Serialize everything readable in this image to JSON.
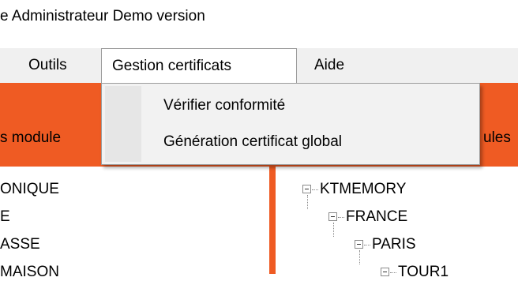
{
  "window": {
    "title": "e Administrateur Demo version"
  },
  "menubar": {
    "items": [
      {
        "label": "Outils"
      },
      {
        "label": "Gestion certificats"
      },
      {
        "label": "Aide"
      }
    ]
  },
  "dropdown": {
    "items": [
      {
        "label": "Vérifier conformité"
      },
      {
        "label": "Génération certificat global"
      }
    ]
  },
  "band": {
    "left_label": "s module",
    "right_label": "ules"
  },
  "left_list": {
    "items": [
      "ONIQUE",
      "E",
      "ASSE",
      "MAISON"
    ]
  },
  "tree": {
    "nodes": [
      "KTMEMORY",
      "FRANCE",
      "PARIS",
      "TOUR1"
    ]
  },
  "colors": {
    "accent": "#ef5b23",
    "menubar_bg": "#f0f0f0",
    "dropdown_bg": "#f2f2f2"
  }
}
